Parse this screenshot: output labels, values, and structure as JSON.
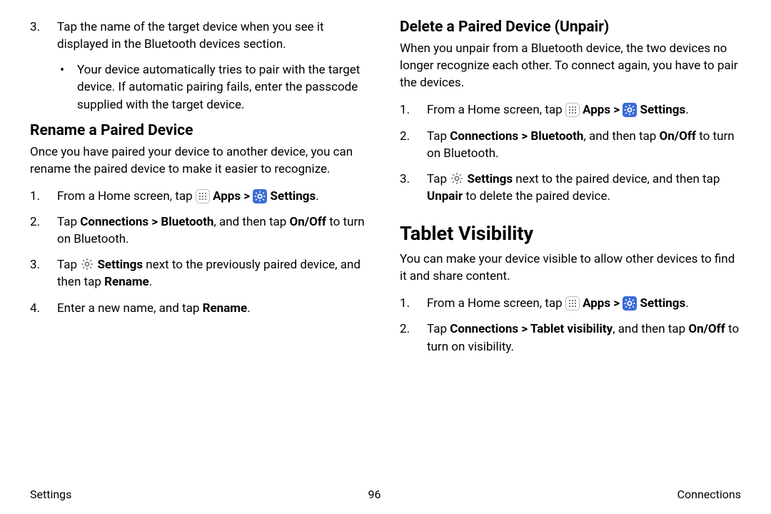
{
  "left": {
    "continued_list_start": 3,
    "continued_items": [
      {
        "main": "Tap the name of the target device when you see it displayed in the Bluetooth devices section.",
        "sub": "Your device automatically tries to pair with the target device. If automatic pairing fails, enter the passcode supplied with the target device."
      }
    ],
    "rename_heading": "Rename a Paired Device",
    "rename_intro": "Once you have paired your device to another device, you can rename the paired device to make it easier to recognize.",
    "rename_steps": {
      "s1_pre": "From a Home screen, tap ",
      "s1_apps": "Apps",
      "s1_sep": " > ",
      "s1_settings": "Settings",
      "s1_post": ".",
      "s2_a": "Tap ",
      "s2_b": "Connections > Bluetooth",
      "s2_c": ", and then tap ",
      "s2_d": "On/Off",
      "s2_e": " to turn on Bluetooth.",
      "s3_a": "Tap ",
      "s3_b": "Settings",
      "s3_c": " next to the previously paired device, and then tap ",
      "s3_d": "Rename",
      "s3_e": ".",
      "s4_a": "Enter a new name, and tap ",
      "s4_b": "Rename",
      "s4_c": "."
    }
  },
  "right": {
    "delete_heading": "Delete a Paired Device (Unpair)",
    "delete_intro": "When you unpair from a Bluetooth device, the two devices no longer recognize each other. To connect again, you have to pair the devices.",
    "delete_steps": {
      "s1_pre": "From a Home screen, tap ",
      "s1_apps": "Apps",
      "s1_sep": " > ",
      "s1_settings": "Settings",
      "s1_post": ".",
      "s2_a": "Tap ",
      "s2_b": "Connections > Bluetooth",
      "s2_c": ", and then tap ",
      "s2_d": "On/Off",
      "s2_e": " to turn on Bluetooth.",
      "s3_a": "Tap ",
      "s3_b": "Settings",
      "s3_c": " next to the paired device, and then tap ",
      "s3_d": "Unpair",
      "s3_e": " to delete the paired device."
    },
    "visibility_heading": "Tablet Visibility",
    "visibility_intro": "You can make your device visible to allow other devices to find it and share content.",
    "visibility_steps": {
      "s1_pre": "From a Home screen, tap ",
      "s1_apps": "Apps",
      "s1_sep": " > ",
      "s1_settings": "Settings",
      "s1_post": ".",
      "s2_a": "Tap ",
      "s2_b": "Connections > Tablet visibility",
      "s2_c": ", and then tap ",
      "s2_d": "On/Off",
      "s2_e": " to turn on visibility."
    }
  },
  "footer": {
    "left": "Settings",
    "center": "96",
    "right": "Connections"
  }
}
